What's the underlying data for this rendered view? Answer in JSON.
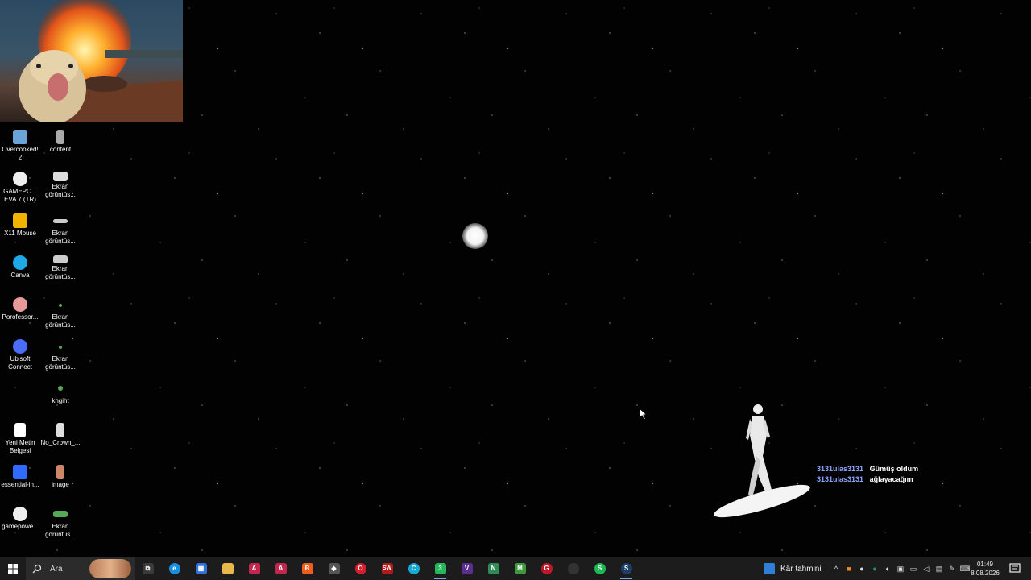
{
  "desktop": {
    "icons_left": [
      {
        "label": "Overcooked! 2",
        "icon": "overcooked-icon",
        "color": "#6aa3d6"
      },
      {
        "label": "GAMEPO... EVA 7 (TR)",
        "icon": "gamepower-icon",
        "color": "#eeeeee"
      },
      {
        "label": "X11 Mouse",
        "icon": "mouse-icon",
        "color": "#f0b400"
      },
      {
        "label": "Canva",
        "icon": "canva-icon",
        "color": "#1fa8e6"
      },
      {
        "label": "Porofessor...",
        "icon": "porofessor-icon",
        "color": "#e89a9a"
      },
      {
        "label": "Ubisoft Connect",
        "icon": "ubisoft-icon",
        "color": "#4a6cf7"
      },
      {
        "label": "Yeni Metin Belgesi",
        "icon": "text-document-icon",
        "color": "#ffffff"
      },
      {
        "label": "essential-in...",
        "icon": "essential-icon",
        "color": "#2f6bff"
      },
      {
        "label": "gamepowe...",
        "icon": "gamepower-icon",
        "color": "#eeeeee"
      }
    ],
    "icons_right": [
      {
        "label": "content",
        "icon": "file-icon",
        "color": "#aaaaaa"
      },
      {
        "label": "Ekran görüntüs...",
        "icon": "screenshot-icon",
        "color": "#dddddd"
      },
      {
        "label": "Ekran görüntüs...",
        "icon": "screenshot-icon",
        "color": "#cccccc"
      },
      {
        "label": "Ekran görüntüs...",
        "icon": "screenshot-icon",
        "color": "#cccccc"
      },
      {
        "label": "Ekran görüntüs...",
        "icon": "screenshot-icon",
        "color": "#55aa55"
      },
      {
        "label": "Ekran görüntüs...",
        "icon": "screenshot-icon",
        "color": "#55aa55"
      },
      {
        "label": "kngiht",
        "icon": "file-icon",
        "color": "#55aa55"
      },
      {
        "label": "No_Crown_...",
        "icon": "file-icon",
        "color": "#dddddd"
      },
      {
        "label": "image",
        "icon": "image-icon",
        "color": "#cc8866"
      },
      {
        "label": "Ekran görüntüs...",
        "icon": "screenshot-icon",
        "color": "#55aa55"
      }
    ]
  },
  "chat": [
    {
      "user": "3131ulas3131",
      "message": "Gümüş oldum"
    },
    {
      "user": "3131ulas3131",
      "message": "ağlayacağım"
    }
  ],
  "taskbar": {
    "search_placeholder": "Ara",
    "apps": [
      {
        "icon": "task-view-icon",
        "color": "#3a3a3a",
        "glyph": "⧉"
      },
      {
        "icon": "edge-icon",
        "color": "#1a8fe0",
        "glyph": "e"
      },
      {
        "icon": "store-icon",
        "color": "#2f73d9",
        "glyph": "▦"
      },
      {
        "icon": "folder-icon",
        "color": "#e8b84a",
        "glyph": ""
      },
      {
        "icon": "acrobat-icon",
        "color": "#c4264e",
        "glyph": "A"
      },
      {
        "icon": "acrobat-icon",
        "color": "#c4264e",
        "glyph": "A"
      },
      {
        "icon": "brave-icon",
        "color": "#f25c1c",
        "glyph": "B"
      },
      {
        "icon": "unity-icon",
        "color": "#555555",
        "glyph": "◆"
      },
      {
        "icon": "opera-icon",
        "color": "#d61f2c",
        "glyph": "O"
      },
      {
        "icon": "saw-game-icon",
        "color": "#b11a1a",
        "glyph": "SW"
      },
      {
        "icon": "browser-icon",
        "color": "#1aa9d6",
        "glyph": "C"
      },
      {
        "icon": "whatsapp-icon",
        "color": "#25b85a",
        "glyph": "3"
      },
      {
        "icon": "visual-studio-icon",
        "color": "#5c2d91",
        "glyph": "V"
      },
      {
        "icon": "notes-icon",
        "color": "#2e8b57",
        "glyph": "N"
      },
      {
        "icon": "minecraft-icon",
        "color": "#3c9a3c",
        "glyph": "M"
      },
      {
        "icon": "opera-gx-icon",
        "color": "#c0182a",
        "glyph": "G"
      },
      {
        "icon": "record-icon",
        "color": "#333333",
        "glyph": ""
      },
      {
        "icon": "spotify-icon",
        "color": "#1db954",
        "glyph": "S"
      },
      {
        "icon": "steam-icon",
        "color": "#1b3f66",
        "glyph": "S"
      }
    ],
    "weather_label": "Kâr tahmini",
    "time": "01:49",
    "date": "8.08.2026"
  }
}
